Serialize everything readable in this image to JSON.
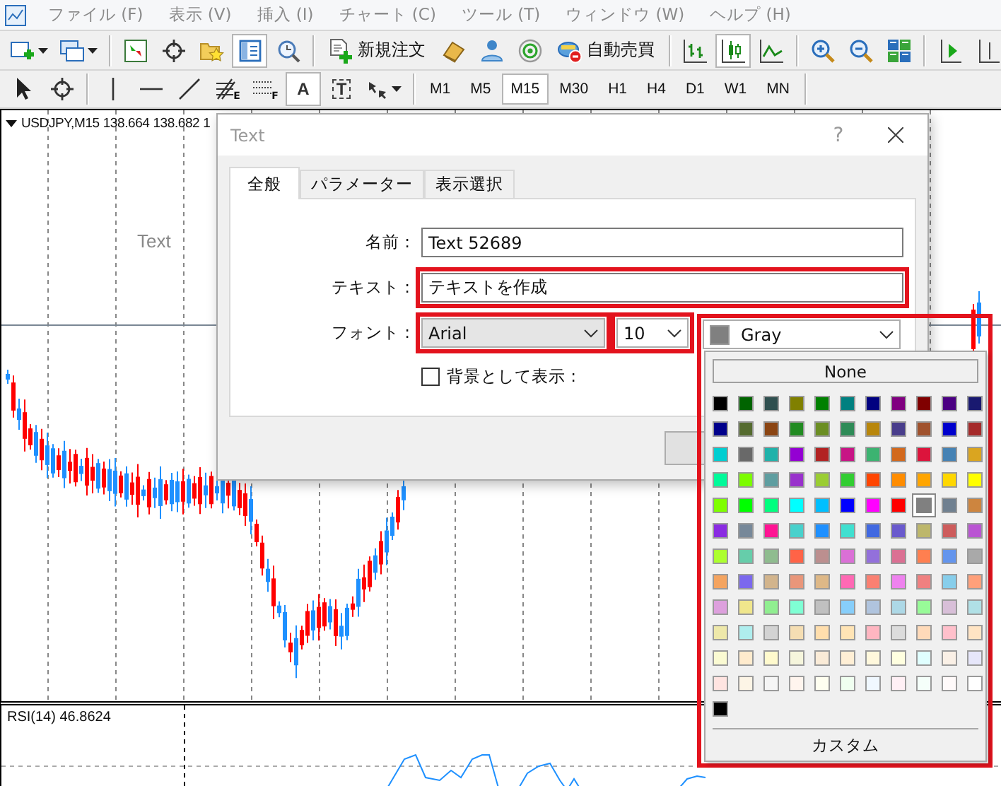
{
  "menu": [
    "ファイル (F)",
    "表示 (V)",
    "挿入 (I)",
    "チャート (C)",
    "ツール (T)",
    "ウィンドウ (W)",
    "ヘルプ (H)"
  ],
  "toolbar": [
    [
      {
        "kind": "new-chart",
        "selected": false
      },
      {
        "kind": "profiles",
        "selected": false
      }
    ],
    [
      {
        "kind": "market-watch",
        "selected": false
      },
      {
        "kind": "data-window",
        "selected": false
      },
      {
        "kind": "favorites",
        "selected": false
      },
      {
        "kind": "navigator",
        "selected": true
      },
      {
        "kind": "tester",
        "selected": false
      }
    ],
    [
      {
        "kind": "new-order",
        "label": "新規注文",
        "selected": false
      },
      {
        "kind": "book",
        "selected": false
      },
      {
        "kind": "user",
        "selected": false
      },
      {
        "kind": "signals",
        "selected": false
      },
      {
        "kind": "auto-trading",
        "label": "自動売買",
        "selected": false
      }
    ],
    [
      {
        "kind": "bar-chart",
        "selected": false
      },
      {
        "kind": "candle-chart",
        "selected": true
      },
      {
        "kind": "line-chart",
        "selected": false
      }
    ],
    [
      {
        "kind": "zoom-in",
        "selected": false
      },
      {
        "kind": "zoom-out",
        "selected": false
      },
      {
        "kind": "tile",
        "selected": false
      }
    ],
    [
      {
        "kind": "auto-scroll",
        "selected": false
      },
      {
        "kind": "chart-shift",
        "selected": false
      }
    ]
  ],
  "tools": [
    [
      {
        "kind": "cursor",
        "selected": false
      },
      {
        "kind": "crosshair",
        "selected": false
      }
    ],
    [
      {
        "kind": "vertical-line",
        "selected": false
      },
      {
        "kind": "horizontal-line",
        "selected": false
      },
      {
        "kind": "trend-line",
        "selected": false
      },
      {
        "kind": "fibonacci",
        "sub": "E",
        "selected": false
      },
      {
        "kind": "fibonacci-dots",
        "sub": "F",
        "selected": false
      },
      {
        "kind": "text",
        "label": "A",
        "selected": true
      },
      {
        "kind": "text-label",
        "label": "T",
        "selected": false
      },
      {
        "kind": "arrows",
        "selected": false
      }
    ]
  ],
  "timeframes": [
    {
      "label": "M1",
      "selected": false
    },
    {
      "label": "M5",
      "selected": false
    },
    {
      "label": "M15",
      "selected": true
    },
    {
      "label": "M30",
      "selected": false
    },
    {
      "label": "H1",
      "selected": false
    },
    {
      "label": "H4",
      "selected": false
    },
    {
      "label": "D1",
      "selected": false
    },
    {
      "label": "W1",
      "selected": false
    },
    {
      "label": "MN",
      "selected": false
    }
  ],
  "chart": {
    "symbol_info": "USDJPY,M15  138.664 138.682 1",
    "object_label": "Text"
  },
  "rsi": {
    "label": "RSI(14) 46.8624"
  },
  "dialog": {
    "title": "Text",
    "help": "?",
    "tabs": [
      {
        "label": "全般",
        "selected": true
      },
      {
        "label": "パラメーター",
        "selected": false
      },
      {
        "label": "表示選択",
        "selected": false
      }
    ],
    "fields": [
      {
        "label": "名前 :",
        "value": "Text 52689",
        "highlighted": false
      },
      {
        "label": "テキスト :",
        "value": "テキストを作成",
        "highlighted": true
      }
    ],
    "font_label": "フォント :",
    "font": {
      "value": "Arial",
      "highlighted": true
    },
    "size": {
      "value": "10",
      "highlighted": true
    },
    "color": {
      "value": "Gray",
      "color": "#808080",
      "highlighted": true,
      "expanded": true
    },
    "background": {
      "label": "背景として表示 :",
      "checked": false
    }
  },
  "color_popup": {
    "none_label": "None",
    "custom_label": "カスタム",
    "swatches": [
      [
        {
          "color": "#000000",
          "selected": false
        },
        {
          "color": "#006400",
          "selected": false
        },
        {
          "color": "#2f4f4f",
          "selected": false
        },
        {
          "color": "#808000",
          "selected": false
        },
        {
          "color": "#008000",
          "selected": false
        },
        {
          "color": "#008080",
          "selected": false
        },
        {
          "color": "#000080",
          "selected": false
        },
        {
          "color": "#800080",
          "selected": false
        },
        {
          "color": "#800000",
          "selected": false
        },
        {
          "color": "#4b0082",
          "selected": false
        },
        {
          "color": "#191970",
          "selected": false
        }
      ],
      [
        {
          "color": "#00008b",
          "selected": false
        },
        {
          "color": "#556b2f",
          "selected": false
        },
        {
          "color": "#8b4513",
          "selected": false
        },
        {
          "color": "#228b22",
          "selected": false
        },
        {
          "color": "#6b8e23",
          "selected": false
        },
        {
          "color": "#2e8b57",
          "selected": false
        },
        {
          "color": "#b8860b",
          "selected": false
        },
        {
          "color": "#483d8b",
          "selected": false
        },
        {
          "color": "#a0522d",
          "selected": false
        },
        {
          "color": "#0000cd",
          "selected": false
        },
        {
          "color": "#a52a2a",
          "selected": false
        }
      ],
      [
        {
          "color": "#00ced1",
          "selected": false
        },
        {
          "color": "#696969",
          "selected": false
        },
        {
          "color": "#20b2aa",
          "selected": false
        },
        {
          "color": "#9400d3",
          "selected": false
        },
        {
          "color": "#b22222",
          "selected": false
        },
        {
          "color": "#c71585",
          "selected": false
        },
        {
          "color": "#3cb371",
          "selected": false
        },
        {
          "color": "#d2691e",
          "selected": false
        },
        {
          "color": "#dc143c",
          "selected": false
        },
        {
          "color": "#4682b4",
          "selected": false
        },
        {
          "color": "#daa520",
          "selected": false
        }
      ],
      [
        {
          "color": "#00fa9a",
          "selected": false
        },
        {
          "color": "#7cfc00",
          "selected": false
        },
        {
          "color": "#5f9ea0",
          "selected": false
        },
        {
          "color": "#9932cc",
          "selected": false
        },
        {
          "color": "#9acd32",
          "selected": false
        },
        {
          "color": "#32cd32",
          "selected": false
        },
        {
          "color": "#ff4500",
          "selected": false
        },
        {
          "color": "#ff8c00",
          "selected": false
        },
        {
          "color": "#ffa500",
          "selected": false
        },
        {
          "color": "#ffd700",
          "selected": false
        },
        {
          "color": "#ffff00",
          "selected": false
        }
      ],
      [
        {
          "color": "#7fff00",
          "selected": false
        },
        {
          "color": "#00ff00",
          "selected": false
        },
        {
          "color": "#00ff7f",
          "selected": false
        },
        {
          "color": "#00ffff",
          "selected": false
        },
        {
          "color": "#00bfff",
          "selected": false
        },
        {
          "color": "#0000ff",
          "selected": false
        },
        {
          "color": "#ff00ff",
          "selected": false
        },
        {
          "color": "#ff0000",
          "selected": false
        },
        {
          "color": "#808080",
          "selected": true
        },
        {
          "color": "#708090",
          "selected": false
        },
        {
          "color": "#cd853f",
          "selected": false
        }
      ],
      [
        {
          "color": "#8a2be2",
          "selected": false
        },
        {
          "color": "#778899",
          "selected": false
        },
        {
          "color": "#ff1493",
          "selected": false
        },
        {
          "color": "#48d1cc",
          "selected": false
        },
        {
          "color": "#1e90ff",
          "selected": false
        },
        {
          "color": "#40e0d0",
          "selected": false
        },
        {
          "color": "#4169e1",
          "selected": false
        },
        {
          "color": "#6a5acd",
          "selected": false
        },
        {
          "color": "#bdb76b",
          "selected": false
        },
        {
          "color": "#cd5c5c",
          "selected": false
        },
        {
          "color": "#ba55d3",
          "selected": false
        }
      ],
      [
        {
          "color": "#adff2f",
          "selected": false
        },
        {
          "color": "#66cdaa",
          "selected": false
        },
        {
          "color": "#8fbc8f",
          "selected": false
        },
        {
          "color": "#ff6347",
          "selected": false
        },
        {
          "color": "#bc8f8f",
          "selected": false
        },
        {
          "color": "#da70d6",
          "selected": false
        },
        {
          "color": "#9370db",
          "selected": false
        },
        {
          "color": "#db7093",
          "selected": false
        },
        {
          "color": "#ff7f50",
          "selected": false
        },
        {
          "color": "#6495ed",
          "selected": false
        },
        {
          "color": "#a9a9a9",
          "selected": false
        }
      ],
      [
        {
          "color": "#f4a460",
          "selected": false
        },
        {
          "color": "#7b68ee",
          "selected": false
        },
        {
          "color": "#d2b48c",
          "selected": false
        },
        {
          "color": "#e9967a",
          "selected": false
        },
        {
          "color": "#deb887",
          "selected": false
        },
        {
          "color": "#ff69b4",
          "selected": false
        },
        {
          "color": "#fa8072",
          "selected": false
        },
        {
          "color": "#ee82ee",
          "selected": false
        },
        {
          "color": "#f08080",
          "selected": false
        },
        {
          "color": "#87ceeb",
          "selected": false
        },
        {
          "color": "#ffa07a",
          "selected": false
        }
      ],
      [
        {
          "color": "#dda0dd",
          "selected": false
        },
        {
          "color": "#f0e68c",
          "selected": false
        },
        {
          "color": "#90ee90",
          "selected": false
        },
        {
          "color": "#7fffd4",
          "selected": false
        },
        {
          "color": "#c0c0c0",
          "selected": false
        },
        {
          "color": "#87cefa",
          "selected": false
        },
        {
          "color": "#b0c4de",
          "selected": false
        },
        {
          "color": "#add8e6",
          "selected": false
        },
        {
          "color": "#98fb98",
          "selected": false
        },
        {
          "color": "#d8bfd8",
          "selected": false
        },
        {
          "color": "#b0e0e6",
          "selected": false
        }
      ],
      [
        {
          "color": "#eee8aa",
          "selected": false
        },
        {
          "color": "#afeeee",
          "selected": false
        },
        {
          "color": "#d3d3d3",
          "selected": false
        },
        {
          "color": "#f5deb3",
          "selected": false
        },
        {
          "color": "#ffdead",
          "selected": false
        },
        {
          "color": "#ffe4b5",
          "selected": false
        },
        {
          "color": "#ffb6c1",
          "selected": false
        },
        {
          "color": "#dcdcdc",
          "selected": false
        },
        {
          "color": "#ffdab9",
          "selected": false
        },
        {
          "color": "#ffc0cb",
          "selected": false
        },
        {
          "color": "#ffe4c4",
          "selected": false
        }
      ],
      [
        {
          "color": "#fafad2",
          "selected": false
        },
        {
          "color": "#ffebcd",
          "selected": false
        },
        {
          "color": "#fffacd",
          "selected": false
        },
        {
          "color": "#f5f5dc",
          "selected": false
        },
        {
          "color": "#faebd7",
          "selected": false
        },
        {
          "color": "#ffefd5",
          "selected": false
        },
        {
          "color": "#fff8dc",
          "selected": false
        },
        {
          "color": "#ffffe0",
          "selected": false
        },
        {
          "color": "#e0ffff",
          "selected": false
        },
        {
          "color": "#faf0e6",
          "selected": false
        },
        {
          "color": "#e6e6fa",
          "selected": false
        }
      ],
      [
        {
          "color": "#ffe4e1",
          "selected": false
        },
        {
          "color": "#fdf5e6",
          "selected": false
        },
        {
          "color": "#f5f5f5",
          "selected": false
        },
        {
          "color": "#fff5ee",
          "selected": false
        },
        {
          "color": "#fffff0",
          "selected": false
        },
        {
          "color": "#f0fff0",
          "selected": false
        },
        {
          "color": "#f0f8ff",
          "selected": false
        },
        {
          "color": "#fff0f5",
          "selected": false
        },
        {
          "color": "#f5fffa",
          "selected": false
        },
        {
          "color": "#fffafa",
          "selected": false
        },
        {
          "color": "#ffffff",
          "selected": false
        }
      ]
    ],
    "custom_swatches": [
      {
        "color": "#000000",
        "selected": false
      }
    ]
  }
}
